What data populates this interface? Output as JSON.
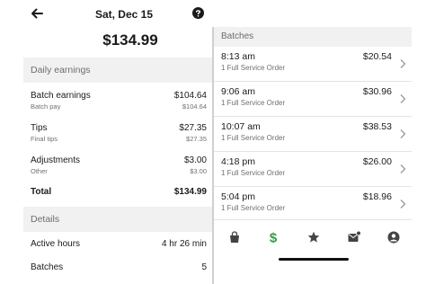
{
  "header": {
    "date": "Sat, Dec 15",
    "total": "$134.99"
  },
  "daily_earnings": {
    "title": "Daily earnings",
    "batch_earnings": {
      "label": "Batch earnings",
      "amount": "$104.64",
      "sub_label": "Batch pay",
      "sub_amount": "$104.64"
    },
    "tips": {
      "label": "Tips",
      "amount": "$27.35",
      "sub_label": "Final tips",
      "sub_amount": "$27.35"
    },
    "adjustments": {
      "label": "Adjustments",
      "amount": "$3.00",
      "sub_label": "Other",
      "sub_amount": "$3.00"
    },
    "total": {
      "label": "Total",
      "amount": "$134.99"
    }
  },
  "details": {
    "title": "Details",
    "active_hours": {
      "label": "Active hours",
      "value": "4 hr 26 min"
    },
    "batches": {
      "label": "Batches",
      "value": "5"
    }
  },
  "batches_panel": {
    "title": "Batches",
    "items": [
      {
        "time": "8:13 am",
        "order": "1 Full Service Order",
        "amount": "$20.54"
      },
      {
        "time": "9:06 am",
        "order": "1 Full Service Order",
        "amount": "$30.96"
      },
      {
        "time": "10:07 am",
        "order": "1 Full Service Order",
        "amount": "$38.53"
      },
      {
        "time": "4:18 pm",
        "order": "1 Full Service Order",
        "amount": "$26.00"
      },
      {
        "time": "5:04 pm",
        "order": "1 Full Service Order",
        "amount": "$18.96"
      }
    ]
  },
  "tabbar": {
    "icons": [
      "shopping-bag-icon",
      "dollar-icon",
      "star-icon",
      "mail-icon",
      "account-icon"
    ],
    "active": "dollar-icon",
    "active_color": "#2e9e3f",
    "inactive_color": "#444444"
  }
}
